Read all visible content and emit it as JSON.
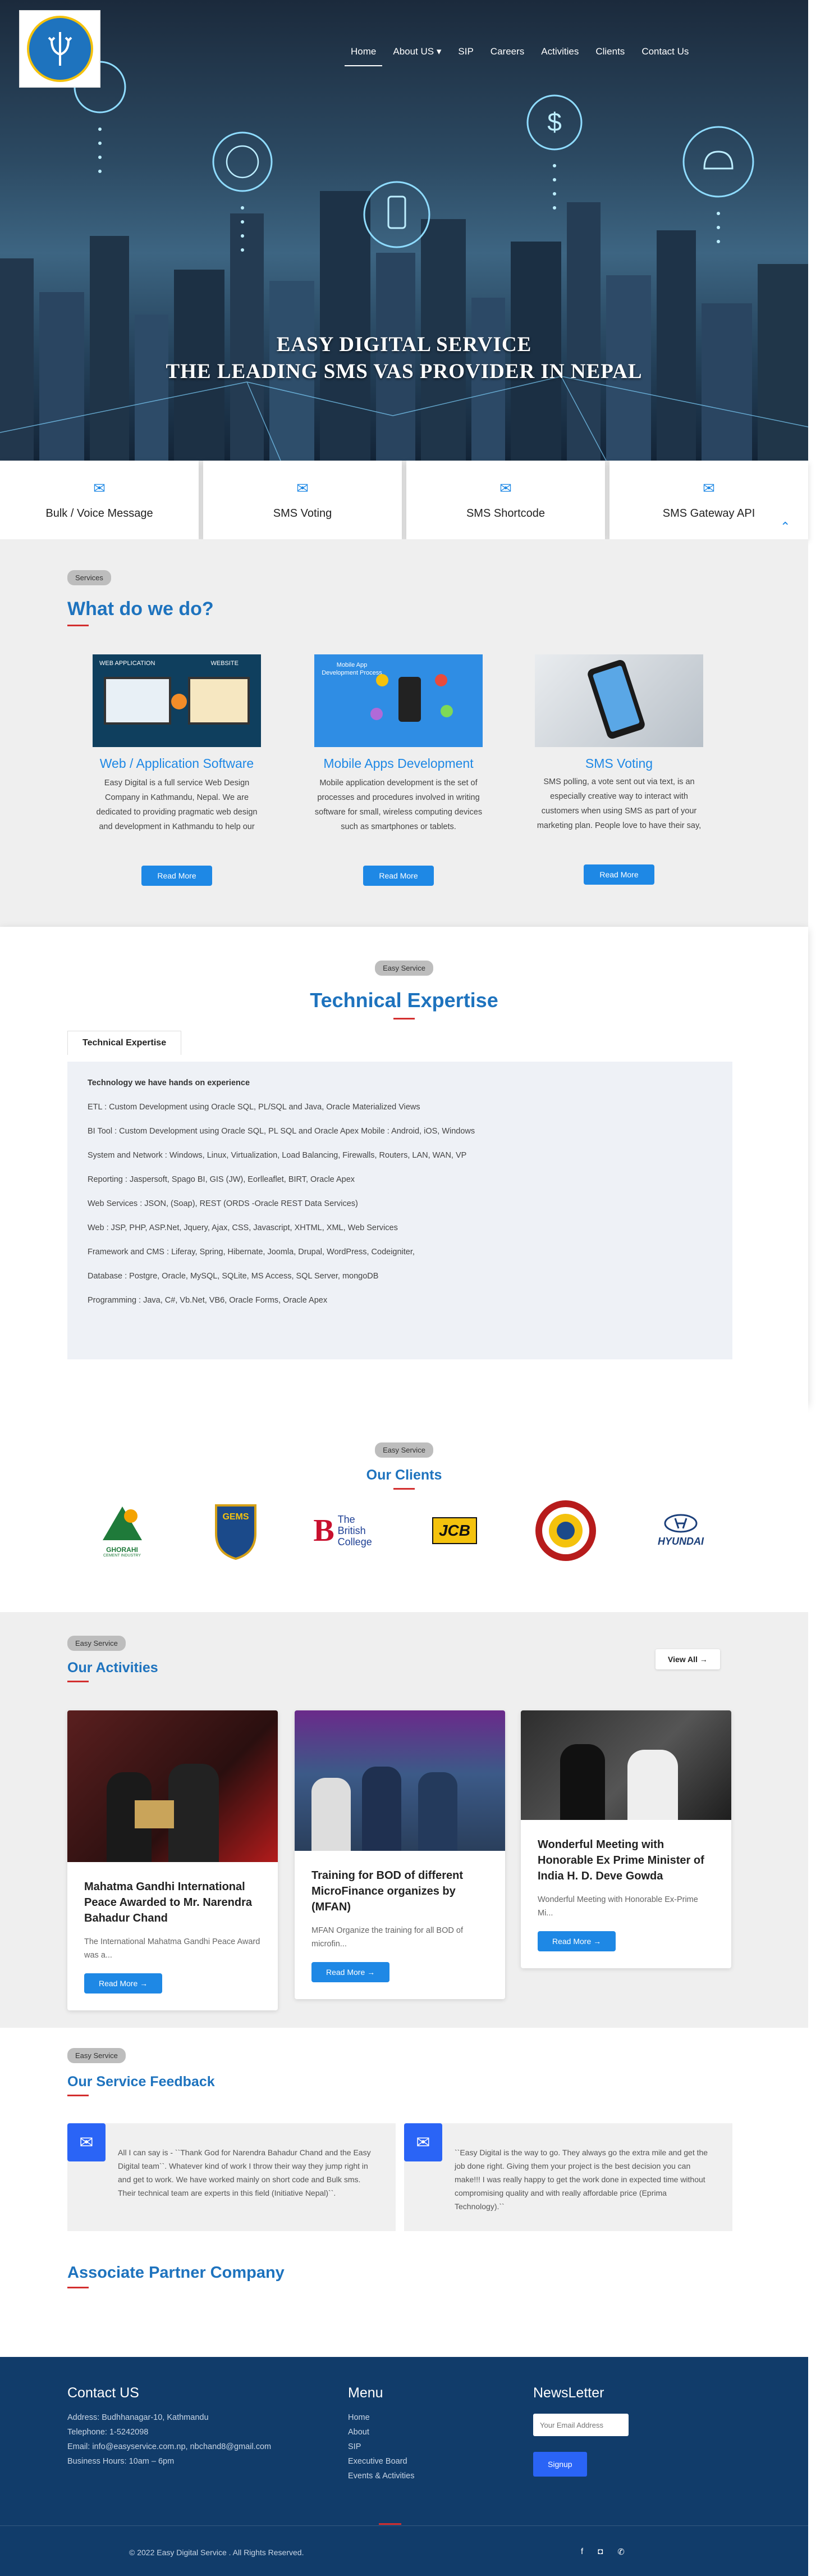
{
  "nav": {
    "items": [
      "Home",
      "About US ▾",
      "SIP",
      "Careers",
      "Activities",
      "Clients",
      "Contact Us"
    ],
    "active": "Home"
  },
  "hero": {
    "line1": "EASY DIGITAL SERVICE",
    "line2": "THE LEADING SMS VAS PROVIDER IN NEPAL"
  },
  "service_tabs": [
    "Bulk / Voice Message",
    "SMS Voting",
    "SMS Shortcode",
    "SMS Gateway API"
  ],
  "services": {
    "tag": "Services",
    "heading": "What do we do?",
    "cards": [
      {
        "title": "Web / Application Software",
        "img_label_left": "WEB APPLICATION",
        "img_label_right": "WEBSITE",
        "text": "Easy Digital is a full service Web Design Company in Kathmandu, Nepal. We are dedicated to providing pragmatic web design and development in Kathmandu to help our",
        "button": "Read More"
      },
      {
        "title": "Mobile Apps Development",
        "img_label_left": "Mobile App Development Process",
        "text": "Mobile application development is the set of processes and procedures involved in writing software for small, wireless computing devices such as smartphones or tablets.",
        "button": "Read More"
      },
      {
        "title": "SMS Voting",
        "text": "SMS polling, a vote sent out via text, is an especially creative way to interact with customers when using SMS as part of your marketing plan. People love to have their say,",
        "button": "Read More"
      }
    ]
  },
  "tech": {
    "tag": "Easy Service",
    "heading": "Technical Expertise",
    "tab": "Technical Expertise",
    "head_line": "Technology we have hands on experience",
    "lines": [
      "ETL :  Custom  Development  using  Oracle  SQL,  PL/SQL  and  Java,  Oracle Materialized Views",
      "BI Tool : Custom Development using Oracle SQL, PL SQL and Oracle Apex Mobile : Android, iOS, Windows",
      "System and Network : Windows, Linux, Virtualization, Load Balancing, Firewalls, Routers, LAN, WAN, VP",
      "Reporting : Jaspersoft, Spago BI, GIS (JW), Eorlleaflet, BIRT, Oracle Apex",
      "Web Services : JSON, (Soap), REST (ORDS -Oracle REST Data Services)",
      "Web : JSP, PHP, ASP.Net, Jquery, Ajax, CSS, Javascript, XHTML, XML, Web Services",
      "Framework and CMS : Liferay, Spring, Hibernate, Joomla, Drupal, WordPress, Codeigniter,",
      "Database : Postgre, Oracle, MySQL, SQLite, MS Access, SQL Server, mongoDB",
      "Programming : Java, C#, Vb.Net, VB6, Oracle Forms, Oracle Apex"
    ]
  },
  "clients": {
    "tag": "Easy Service",
    "heading": "Our Clients",
    "logos": [
      {
        "name": "GHORAHI",
        "sub": "CEMENT INDUSTRY"
      },
      {
        "name": "GEMS"
      },
      {
        "name": "The British College"
      },
      {
        "name": "JCB"
      },
      {
        "name": "seal"
      },
      {
        "name": "HYUNDAI"
      }
    ]
  },
  "activities": {
    "tag": "Easy Service",
    "heading": "Our Activities",
    "view_all": "View All",
    "cards": [
      {
        "title": "Mahatma Gandhi International Peace Awarded to Mr. Narendra Bahadur Chand",
        "text": "The International Mahatma Gandhi Peace Award was a...",
        "button": "Read More"
      },
      {
        "title": "Training for BOD of different MicroFinance organizes by (MFAN)",
        "text": "MFAN Organize the training for all BOD of microfin...",
        "button": "Read More"
      },
      {
        "title": "Wonderful Meeting with Honorable Ex Prime Minister of India H. D. Deve Gowda",
        "text": "Wonderful Meeting with Honorable Ex-Prime Mi...",
        "button": "Read More"
      }
    ]
  },
  "feedback": {
    "tag": "Easy Service",
    "heading": "Our Service Feedback",
    "items": [
      "All I can say is - ``Thank God for Narendra Bahadur Chand and the Easy Digital team``. Whatever kind of work I throw their way they jump right in and get to work. We have worked mainly on short code and Bulk sms. Their technical team are experts in this field (Initiative Nepal)``.",
      "``Easy Digital is the way to go. They always go the extra mile and get the job done right. Giving them your project is the best decision you can make!!! I was really happy to get the work done in expected time without compromising quality and with really affordable price (Eprima Technology).``"
    ],
    "partner_heading": "Associate Partner Company"
  },
  "footer": {
    "contact_title": "Contact US",
    "contact_lines": [
      "Address: Budhhanagar-10, Kathmandu",
      "Telephone: 1-5242098",
      "Email: info@easyservice.com.np, nbchand8@gmail.com",
      "Business Hours: 10am – 6pm"
    ],
    "menu_title": "Menu",
    "menu_items": [
      "Home",
      "About",
      "SIP",
      "Executive Board",
      "Events & Activities"
    ],
    "news_title": "NewsLetter",
    "email_placeholder": "Your Email Address",
    "signup": "Signup",
    "copyright": "© 2022 Easy Digital Service . All Rights Reserved."
  },
  "colors": {
    "accent": "#1e88e5",
    "heading": "#1e73be",
    "underline": "#d32f2f",
    "footer": "#113c6a",
    "feedback_icon": "#2a64f6"
  }
}
